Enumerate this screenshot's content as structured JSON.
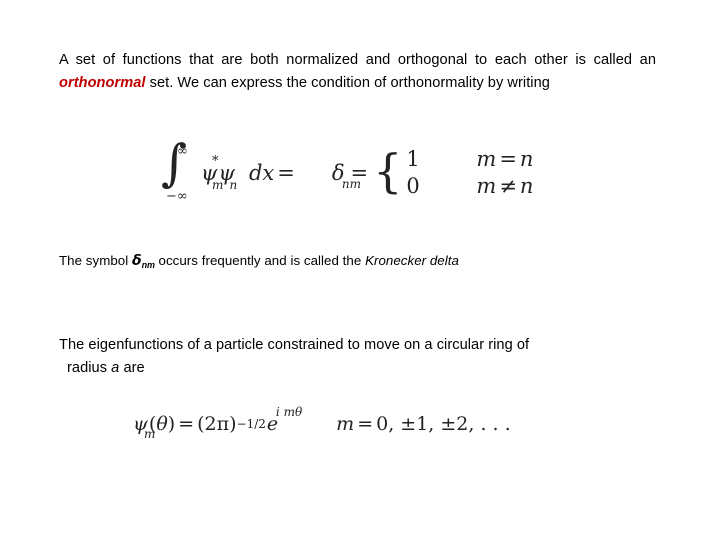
{
  "slide": {
    "background_color": "#ffffff",
    "accent_color": "#C00000",
    "text_color": "#000000",
    "equation_color": "#232323"
  },
  "paragraph_intro": {
    "line1": "A set of functions that are both normalized and orthogonal to each other",
    "line2_before": "is called an",
    "keyword": "orthonormal",
    "line2_after": "set. We can express the condition of",
    "line3": "orthonormality by writing"
  },
  "equation_orthonormality": {
    "integral_lower_limit": "−∞",
    "integral_upper_limit": "∞",
    "integral_sign": "∫",
    "integrand_psi_star": "ψ",
    "integrand_star": "*",
    "integrand_sub_m": "m",
    "integrand_psi_n": "ψ",
    "integrand_sub_n": "n",
    "differential": "dx",
    "equals": "=",
    "delta_symbol": "δ",
    "delta_subscript": "nm",
    "delta_equals": "=",
    "brace_open": "{",
    "case_1_value": "1",
    "case_1_condition_left": "m",
    "case_1_condition_op": "=",
    "case_1_condition_right": "n",
    "case_2_value": "0",
    "case_2_condition_left": "m",
    "case_2_condition_op": "≠",
    "case_2_condition_right": "n"
  },
  "paragraph_symbol": {
    "before": "The symbol",
    "delta": "δ",
    "delta_subscript": "nm",
    "middle": "occurs frequently and is called the",
    "italic_term": "Kronecker delta"
  },
  "paragraph_eigen": {
    "line1": "The eigenfunctions of a particle constrained to move on a circular ring of",
    "line2_before": "radius",
    "line2_italic": "a",
    "line2_after": "are"
  },
  "equation_eigenfunction": {
    "psi": "ψ",
    "psi_subscript": "m",
    "paren_open": "(",
    "theta": "θ",
    "paren_close": ")",
    "equals": "=",
    "base_open": "(",
    "two_pi": "2π",
    "base_close": ")",
    "exponent": "−1/2",
    "e": "e",
    "e_exponent": "i mθ",
    "m_label": "m",
    "m_equals": "=",
    "m_values": "0, ±1, ±2, . . ."
  }
}
